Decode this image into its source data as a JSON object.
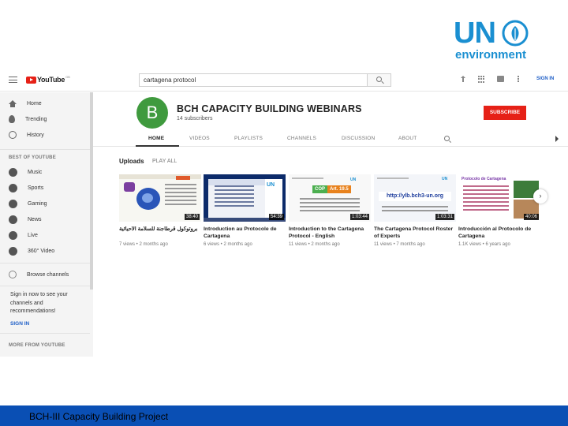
{
  "logo": {
    "letters": "UN",
    "subtitle": "environment",
    "accent": "#1a8fd1"
  },
  "topbar": {
    "search_value": "cartagena protocol",
    "signin_label": "SIGN IN",
    "icons": [
      "menu-icon",
      "upload-icon",
      "apps-icon",
      "messages-icon",
      "more-icon"
    ]
  },
  "sidebar": {
    "items": [
      {
        "label": "Home",
        "icon": "home-icon"
      },
      {
        "label": "Trending",
        "icon": "flame-icon"
      },
      {
        "label": "History",
        "icon": "history-icon"
      }
    ],
    "best_heading": "BEST OF YOUTUBE",
    "best_items": [
      {
        "label": "Music",
        "icon": "music-icon"
      },
      {
        "label": "Sports",
        "icon": "sports-icon"
      },
      {
        "label": "Gaming",
        "icon": "gaming-icon"
      },
      {
        "label": "News",
        "icon": "news-icon"
      },
      {
        "label": "Live",
        "icon": "live-icon"
      },
      {
        "label": "360° Video",
        "icon": "video360-icon"
      }
    ],
    "browse": "Browse channels",
    "signin_prompt": "Sign in now to see your channels and recommendations!",
    "signin_link": "SIGN IN",
    "more_heading": "MORE FROM YOUTUBE"
  },
  "channel": {
    "avatar_letter": "B",
    "avatar_color": "#3f9a3e",
    "name": "BCH CAPACITY BUILDING WEBINARS",
    "subscribers": "14 subscribers",
    "subscribe_label": "SUBSCRIBE",
    "tabs": [
      "HOME",
      "VIDEOS",
      "PLAYLISTS",
      "CHANNELS",
      "DISCUSSION",
      "ABOUT"
    ]
  },
  "uploads": {
    "title": "Uploads",
    "play_all": "PLAY ALL",
    "videos": [
      {
        "title": "بروتوكول قرطاجنة للسلامة الأحيائية",
        "meta": "7 views • 2 months ago",
        "duration": "38:40"
      },
      {
        "title": "Introduction au Protocole de Cartagena",
        "meta": "6 views • 2 months ago",
        "duration": "54:39"
      },
      {
        "title": "Introduction to the Cartagena Protocol - English",
        "meta": "11 views • 2 months ago",
        "duration": "1:03:44"
      },
      {
        "title": "The Cartagena Protocol Roster of Experts",
        "meta": "11 views • 7 months ago",
        "duration": "1:03:31"
      },
      {
        "title": "Introducción al Protocolo de Cartagena",
        "meta": "1.1K views • 6 years ago",
        "duration": "40:06"
      }
    ],
    "thumb_text": {
      "t2_un": "UN",
      "t3_badge_left": "COP",
      "t3_badge_right": "Art. 19.5",
      "t3_un": "UN",
      "t4_url": "http://ylb.bch3-un.org",
      "t4_un": "UN",
      "t5_title": "Protocolo de Cartagena"
    }
  },
  "footer": {
    "text": "BCH-III Capacity Building Project",
    "color": "#0a4fb4"
  }
}
